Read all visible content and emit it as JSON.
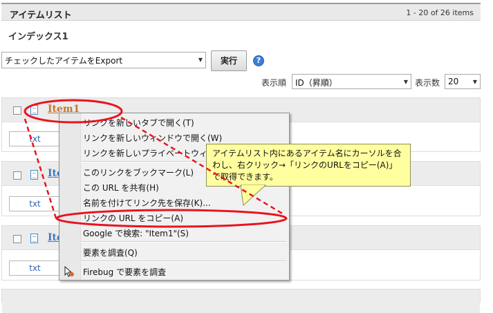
{
  "header": {
    "title": "アイテムリスト",
    "count": "1 - 20 of 26 items"
  },
  "index": {
    "label": "インデックス1"
  },
  "export_bar": {
    "select_value": "チェックしたアイテムをExport",
    "run_label": "実行",
    "help_icon": "?"
  },
  "sort_bar": {
    "order_label": "表示順",
    "order_value": "ID（昇順）",
    "count_label": "表示数",
    "count_value": "20"
  },
  "items": [
    {
      "title": "Item1",
      "format": "txt"
    },
    {
      "title": "Ite",
      "format": "txt"
    },
    {
      "title": "Ite",
      "format": "txt"
    }
  ],
  "context_menu": {
    "items": [
      "リンクを新しいタブで開く(T)",
      "リンクを新しいウィンドウで開く(W)",
      "リンクを新しいプライベートウィ",
      "このリンクをブックマーク(L)",
      "この URL を共有(H)",
      "名前を付けてリンク先を保存(K)...",
      "リンクの URL をコピー(A)",
      "Google で検索: \"Item1\"(S)",
      "要素を調査(Q)",
      "Firebug で要素を調査"
    ]
  },
  "tooltip": {
    "text": "アイテムリスト内にあるアイテム名にカーソルを合わし、右クリック→「リンクのURLをコピー(A)」で取得できます。"
  },
  "colors": {
    "annotation": "#e8141e",
    "tooltip_bg": "#ffffa0",
    "link_orange": "#c8742a",
    "link_blue": "#3b76c4"
  }
}
